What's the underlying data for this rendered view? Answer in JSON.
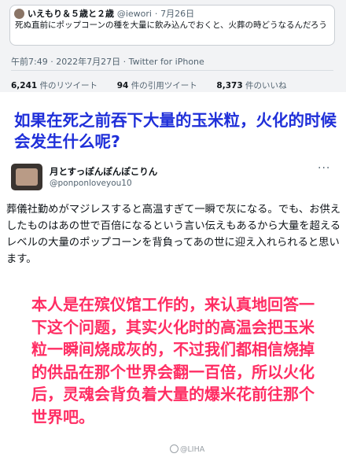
{
  "quoted_tweet": {
    "name": "いえもり＆５歳と２歳",
    "handle": "@iewori",
    "date": "7月26日",
    "text": "死ぬ直前にポップコーンの種を大量に飲み込んでおくと、火葬の時どうなるんだろう"
  },
  "tweet_meta": {
    "time": "午前7:49 · 2022年7月27日 · Twitter for iPhone"
  },
  "stats": {
    "retweets": "6,241",
    "retweets_label": "件のリツイート",
    "quotes": "94",
    "quotes_label": "件の引用ツイート",
    "likes": "8,373",
    "likes_label": "件のいいね"
  },
  "caption_question": "如果在死之前吞下大量的玉米粒，火化的时候会发生什么呢?",
  "reply": {
    "name": "月とすっぽんぽんぽこりん",
    "handle": "@ponponloveyou10",
    "text": "葬儀社勤めがマジレスすると高温すぎて一瞬で灰になる。でも、お供えしたものはあの世で百倍になるという言い伝えもあるから大量を超えるレベルの大量のポップコーンを背負ってあの世に迎え入れられると思います。"
  },
  "caption_answer": "本人是在殡仪馆工作的，来认真地回答一下这个问题，其实火化时的高温会把玉米粒一瞬间烧成灰的，不过我们都相信烧掉的供品在那个世界会翻一百倍，所以火化后，灵魂会背负着大量的爆米花前往那个世界吧。",
  "watermark": "@LIHA",
  "colors": {
    "question_blue": "#1f2fd9",
    "answer_pink": "#ff2d63"
  }
}
